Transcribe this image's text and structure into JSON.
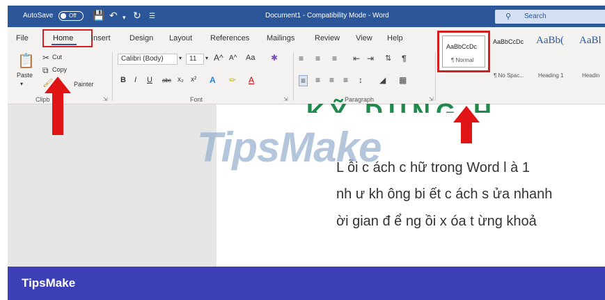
{
  "titlebar": {
    "autosave_label": "AutoSave",
    "autosave_state": "Off",
    "document_title": "Document1  -  Compatibility Mode  -  Word",
    "search_placeholder": "Search"
  },
  "ribbon": {
    "tabs": [
      "File",
      "Home",
      "Insert",
      "Design",
      "Layout",
      "References",
      "Mailings",
      "Review",
      "View",
      "Help"
    ],
    "active_tab": "Home",
    "clipboard": {
      "paste_label": "Paste",
      "cut_label": "Cut",
      "copy_label": "Copy",
      "format_painter_label": "Painter",
      "group_label": "Clipb"
    },
    "font": {
      "font_name": "Calibri (Body)",
      "font_size": "11",
      "grow_label": "A^",
      "shrink_label": "A^",
      "case_label": "Aa",
      "bold": "B",
      "italic": "I",
      "underline": "U",
      "strike": "abc",
      "subscript": "x₂",
      "superscript": "x²",
      "group_label": "Font"
    },
    "paragraph": {
      "group_label": "Paragraph"
    },
    "styles": {
      "items": [
        {
          "sample": "AaBbCcDc",
          "name": "¶ Normal"
        },
        {
          "sample": "AaBbCcDc",
          "name": "¶ No Spac..."
        },
        {
          "sample": "AaBb(",
          "name": "Heading 1"
        },
        {
          "sample": "AaBl",
          "name": "Headin"
        }
      ]
    }
  },
  "document": {
    "heading_partial": "KỸ DỤNG H",
    "lines": [
      "L ỗi  c ách c  hữ  trong Word l à 1",
      "nh ư kh ông bi ết c ách s ửa nhanh",
      "ời gian đ  ể ng  ồi x óa t  ừng khoả"
    ]
  },
  "watermark": "TipsMake",
  "brand_bar": "TipsMake",
  "colors": {
    "title_bar": "#2b579a",
    "highlight": "#d32020",
    "brand_bar": "#3d3fb6",
    "heading_text": "#1f8a4c"
  }
}
